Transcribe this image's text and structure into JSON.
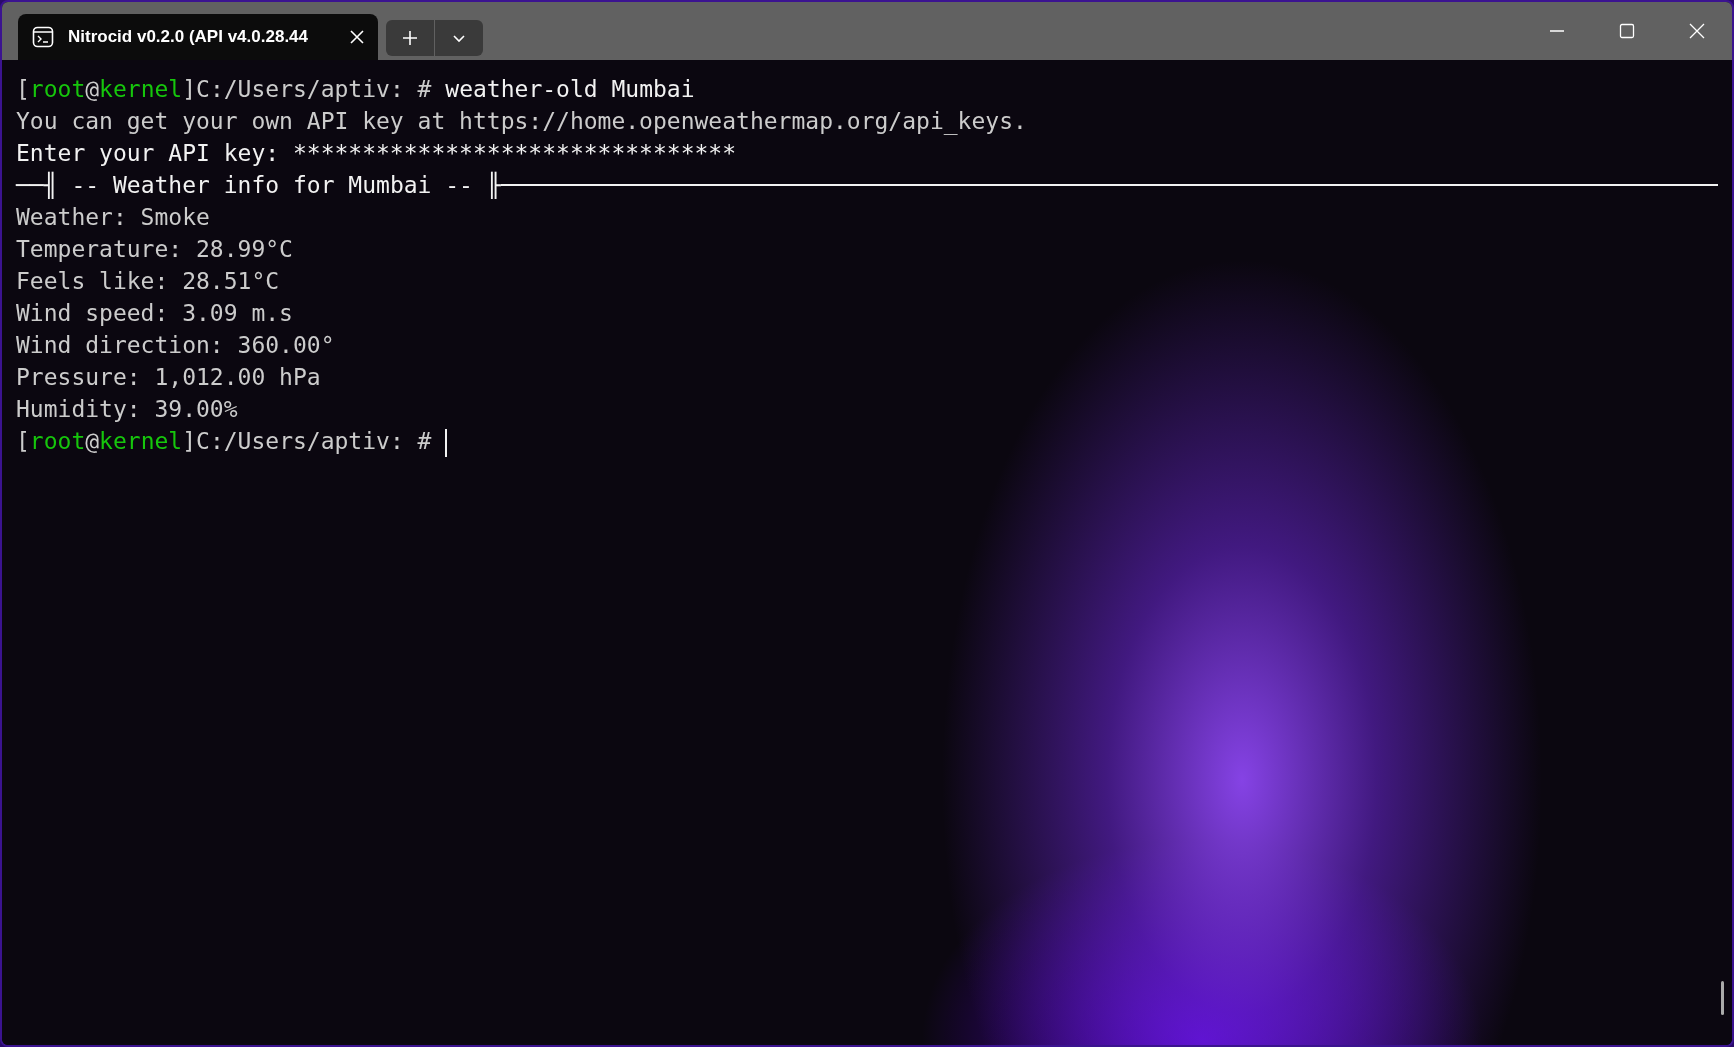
{
  "window": {
    "tab": {
      "title": "Nitrocid v0.2.0 (API v4.0.28.44",
      "selected": true
    }
  },
  "terminal": {
    "lines": [
      {
        "kind": "prompt",
        "segments": [
          {
            "text": "[",
            "color": "#cccccc"
          },
          {
            "text": "root",
            "color": "#16c60c"
          },
          {
            "text": "@",
            "color": "#cccccc"
          },
          {
            "text": "kernel",
            "color": "#16c60c"
          },
          {
            "text": "]C:/Users/aptiv: # ",
            "color": "#cccccc"
          },
          {
            "text": "weather-old Mumbai",
            "color": "#f2f2f2"
          }
        ],
        "cursor": false
      },
      {
        "kind": "text",
        "text": "You can get your own API key at https://home.openweathermap.org/api_keys.",
        "bright": false
      },
      {
        "kind": "text",
        "text": "Enter your API key: ********************************",
        "bright": true
      },
      {
        "kind": "header",
        "left": "──╢",
        "title": " -- Weather info for Mumbai -- ",
        "right": "╟"
      },
      {
        "kind": "text",
        "text": "Weather: Smoke",
        "bright": false
      },
      {
        "kind": "text",
        "text": "Temperature: 28.99°C",
        "bright": false
      },
      {
        "kind": "text",
        "text": "Feels like: 28.51°C",
        "bright": false
      },
      {
        "kind": "text",
        "text": "Wind speed: 3.09 m.s",
        "bright": false
      },
      {
        "kind": "text",
        "text": "Wind direction: 360.00°",
        "bright": false
      },
      {
        "kind": "text",
        "text": "Pressure: 1,012.00 hPa",
        "bright": false
      },
      {
        "kind": "text",
        "text": "Humidity: 39.00%",
        "bright": false
      },
      {
        "kind": "prompt",
        "segments": [
          {
            "text": "[",
            "color": "#cccccc"
          },
          {
            "text": "root",
            "color": "#16c60c"
          },
          {
            "text": "@",
            "color": "#cccccc"
          },
          {
            "text": "kernel",
            "color": "#16c60c"
          },
          {
            "text": "]C:/Users/aptiv: # ",
            "color": "#cccccc"
          }
        ],
        "cursor": true
      }
    ]
  }
}
